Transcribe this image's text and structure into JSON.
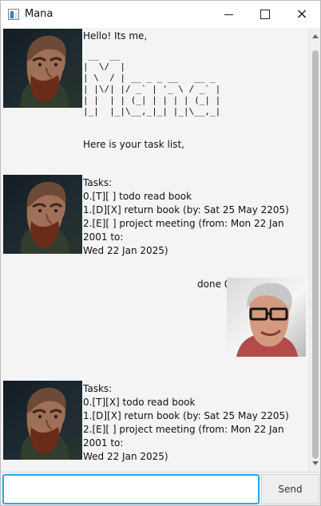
{
  "window": {
    "title": "Mana",
    "controls": [
      "minimize",
      "maximize",
      "close"
    ]
  },
  "messages": {
    "m1": {
      "greeting": "Hello! Its me,",
      "ascii_art": " __  __\n|  \\/  |\n| \\  / | __ _ _ __   __ _\n| |\\/| |/ _` | '_ \\ / _` |\n| |  | | (_| | | | | (_| |\n|_|  |_|\\__,_|_| |_|\\__,_|",
      "prompt": "Here is your task list,"
    },
    "m2": {
      "text": "Tasks:\n0.[T][ ] todo read book\n1.[D][X] return book (by: Sat 25 May 2205)\n2.[E][ ] project meeting (from: Mon 22 Jan 2001 to:\nWed 22 Jan 2025)"
    },
    "m3": {
      "text": "done 0"
    },
    "m4": {
      "text": "Tasks:\n0.[T][X] todo read book\n1.[D][X] return book (by: Sat 25 May 2205)\n2.[E][ ] project meeting (from: Mon 22 Jan 2001 to:\nWed 22 Jan 2025)"
    }
  },
  "input": {
    "value": "",
    "placeholder": ""
  },
  "send_button": {
    "label": "Send"
  },
  "colors": {
    "input_focus": "#27a7ee",
    "background": "#f4f4f4"
  }
}
